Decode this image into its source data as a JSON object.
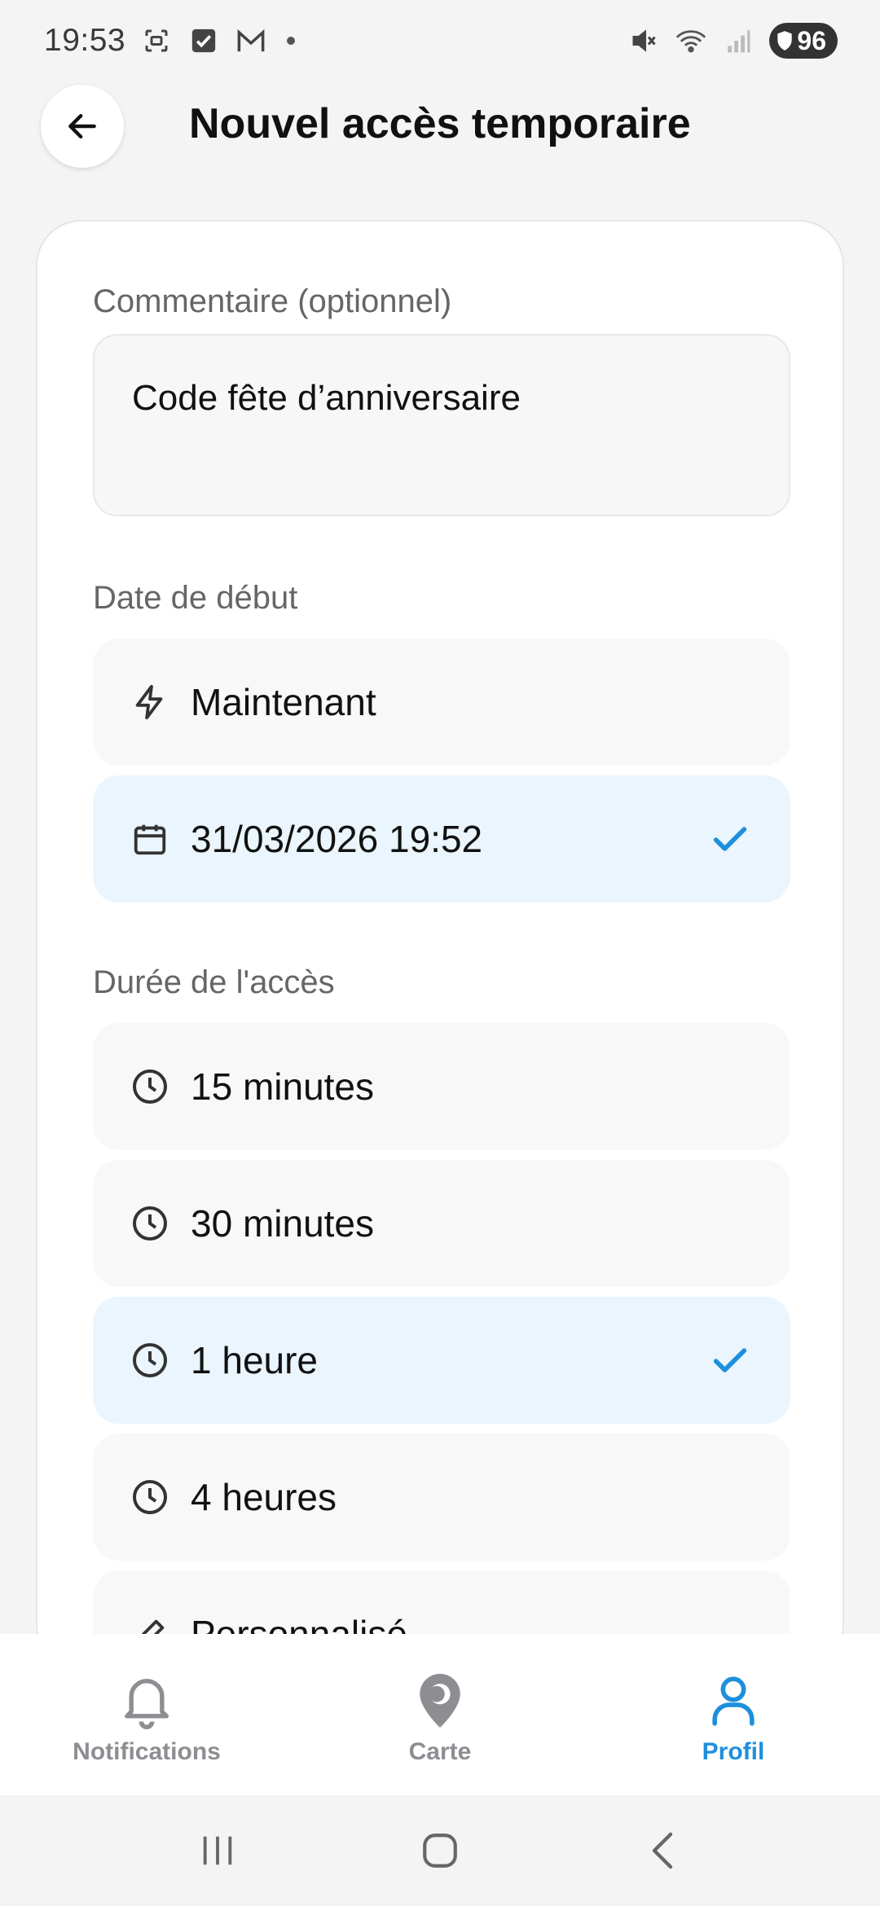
{
  "status_bar": {
    "time": "19:53",
    "battery": "96"
  },
  "header": {
    "title": "Nouvel accès temporaire"
  },
  "form": {
    "comment": {
      "label": "Commentaire (optionnel)",
      "value": "Code fête d’anniversaire"
    },
    "start_date": {
      "label": "Date de début",
      "options": [
        {
          "label": "Maintenant",
          "icon": "lightning-icon",
          "selected": false
        },
        {
          "label": "31/03/2026 19:52",
          "icon": "calendar-icon",
          "selected": true
        }
      ]
    },
    "duration": {
      "label": "Durée de l'accès",
      "options": [
        {
          "label": "15 minutes",
          "icon": "clock-icon",
          "selected": false
        },
        {
          "label": "30 minutes",
          "icon": "clock-icon",
          "selected": false
        },
        {
          "label": "1 heure",
          "icon": "clock-icon",
          "selected": true
        },
        {
          "label": "4 heures",
          "icon": "clock-icon",
          "selected": false
        },
        {
          "label": "Personnalisé",
          "icon": "pencil-icon",
          "selected": false
        }
      ]
    }
  },
  "bottom_nav": {
    "items": [
      {
        "label": "Notifications",
        "icon": "bell-icon",
        "active": false
      },
      {
        "label": "Carte",
        "icon": "map-pin-icon",
        "active": false
      },
      {
        "label": "Profil",
        "icon": "user-icon",
        "active": true
      }
    ]
  },
  "colors": {
    "accent": "#1e8fdc",
    "selected_bg": "#eaf5fd",
    "option_bg": "#f8f8f9"
  }
}
